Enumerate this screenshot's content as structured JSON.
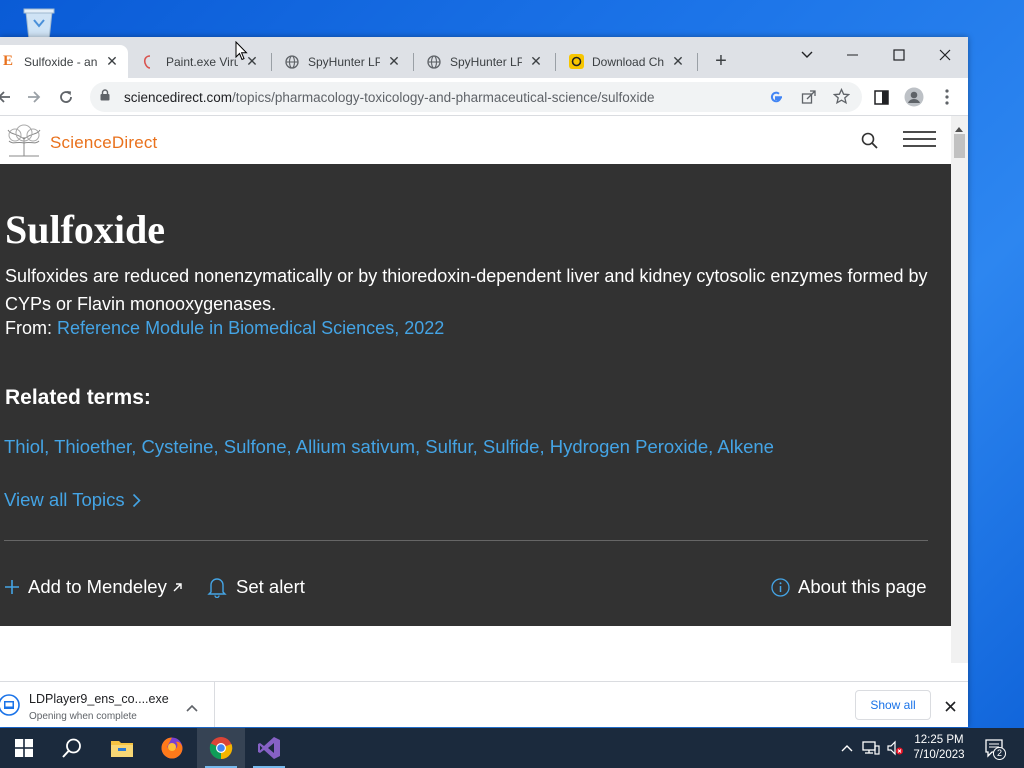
{
  "browser": {
    "tabs": [
      {
        "label": "Sulfoxide - an",
        "active": true
      },
      {
        "label": "Paint.exe Virus",
        "active": false
      },
      {
        "label": "SpyHunter LP",
        "active": false
      },
      {
        "label": "SpyHunter LP",
        "active": false
      },
      {
        "label": "Download Cha",
        "active": false
      }
    ],
    "new_tab_symbol": "+",
    "url_host": "sciencedirect.com",
    "url_path": "/topics/pharmacology-toxicology-and-pharmaceutical-science/sulfoxide"
  },
  "site": {
    "logo_text": "ScienceDirect"
  },
  "article": {
    "title": "Sulfoxide",
    "description": "Sulfoxides are reduced nonenzymatically or by thioredoxin-dependent liver and kidney cytosolic enzymes formed by CYPs or Flavin monooxygenases.",
    "from_label": "From:",
    "from_source": "Reference Module in Biomedical Sciences, 2022",
    "related_heading": "Related terms:",
    "related_terms": [
      "Thiol",
      "Thioether",
      "Cysteine",
      "Sulfone",
      "Allium sativum",
      "Sulfur",
      "Sulfide",
      "Hydrogen Peroxide",
      "Alkene"
    ],
    "view_all": "View all Topics",
    "actions": {
      "mendeley": "Add to Mendeley",
      "alert": "Set alert",
      "about": "About this page"
    }
  },
  "downloads": {
    "file_name": "LDPlayer9_ens_co....exe",
    "status": "Opening when complete",
    "show_all": "Show all"
  },
  "taskbar": {
    "time": "12:25 PM",
    "date": "7/10/2023",
    "notification_count": "2"
  },
  "colors": {
    "accent_link": "#44a4e5",
    "sd_orange": "#e9711c",
    "hero_bg": "#323232"
  }
}
